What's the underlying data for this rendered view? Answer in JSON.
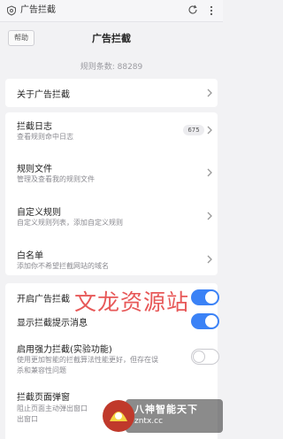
{
  "browser": {
    "title": "广告拦截"
  },
  "header": {
    "back_label": "帮助",
    "title": "广告拦截"
  },
  "rule_count": "规则条数: 88289",
  "items": [
    {
      "title": "关于广告拦截"
    },
    {
      "title": "拦截日志",
      "subtitle": "查看规则命中日志",
      "badge": "675"
    },
    {
      "title": "规则文件",
      "subtitle": "管理及查看我的规则文件"
    },
    {
      "title": "自定义规则",
      "subtitle": "自定义规则列表，添加自定义规则"
    },
    {
      "title": "白名单",
      "subtitle": "添加你不希望拦截网站的域名"
    }
  ],
  "toggles": [
    {
      "title": "开启广告拦截",
      "on": true
    },
    {
      "title": "显示拦截提示消息",
      "on": true
    },
    {
      "title": "启用强力拦截(实验功能)",
      "subtitle_1": "使用更加智能的拦截算法性能更好，但存在误",
      "subtitle_2": "杀和兼容性问题",
      "on": false
    },
    {
      "title": "拦截页面弹窗",
      "subtitle_1": "阻止页面主动弹出窗口",
      "subtitle_2": "出窗口"
    }
  ],
  "watermark": {
    "text": "文龙资源站",
    "logo_line1": "八神智能天下",
    "logo_line2": "zntx.cc"
  },
  "colors": {
    "accent": "#3b82f6",
    "background": "#f2f2f4",
    "watermark": "#e33b3b"
  }
}
